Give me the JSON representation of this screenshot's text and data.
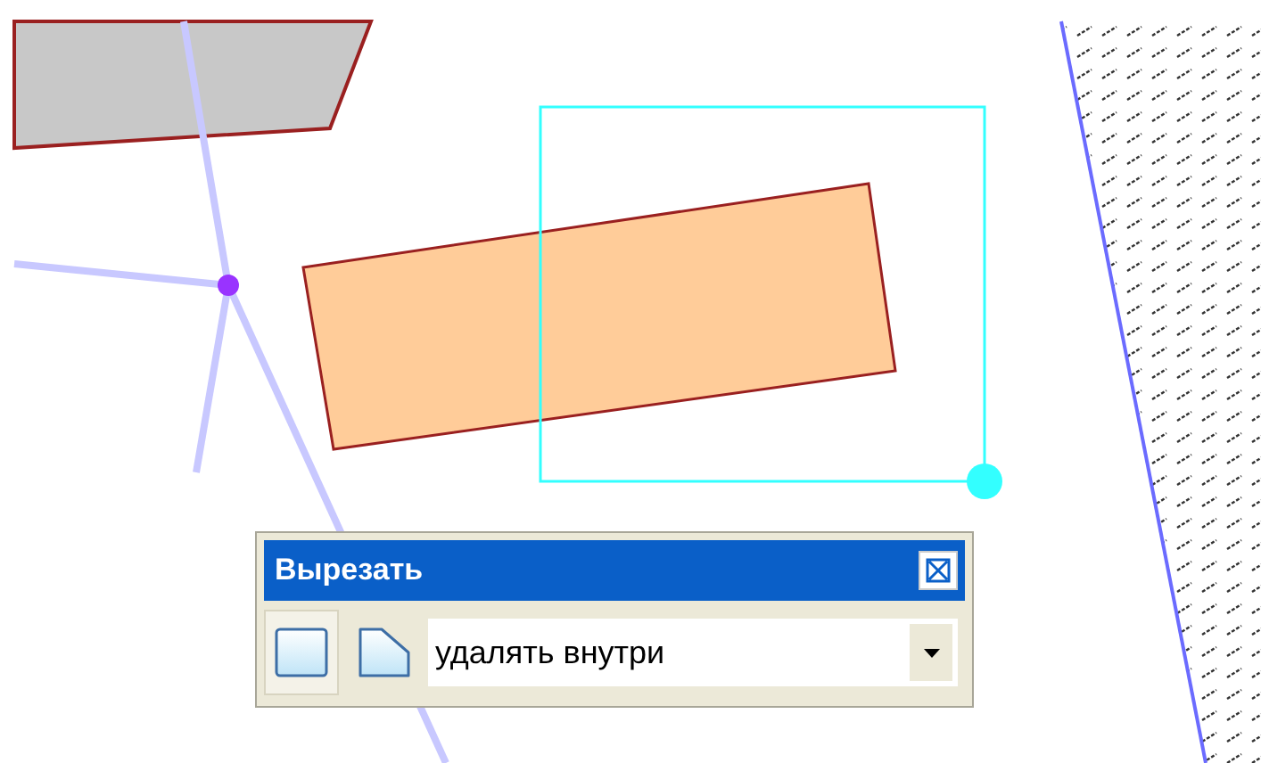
{
  "toolbar": {
    "title": "Вырезать",
    "modes": [
      {
        "kind": "rect",
        "selected": true
      },
      {
        "kind": "cut-corner",
        "selected": false
      }
    ],
    "dropdown": {
      "value": "удалять внутри"
    }
  }
}
